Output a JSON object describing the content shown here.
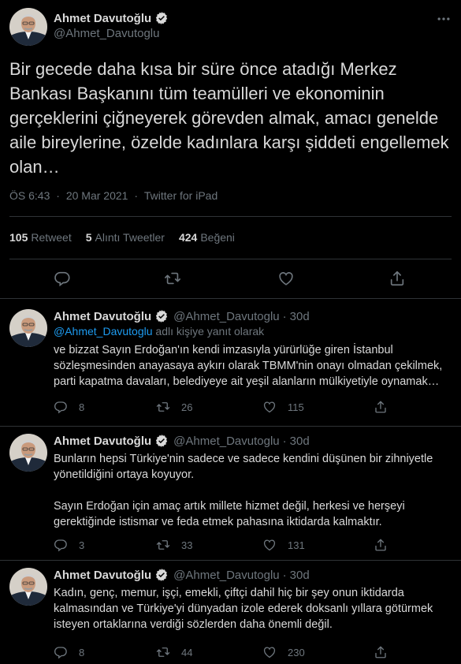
{
  "main_tweet": {
    "author_name": "Ahmet Davutoğlu",
    "handle": "@Ahmet_Davutoglu",
    "text": "Bir gecede daha kısa bir süre önce atadığı Merkez Bankası Başkanını tüm teamülleri ve ekonominin gerçeklerini çiğneyerek görevden almak, amacı genelde aile bireylerine, özelde kadınlara karşı şiddeti engellemek olan…",
    "time": "ÖS 6:43",
    "date": "20 Mar 2021",
    "source": "Twitter for iPad",
    "separator": "·",
    "stats": {
      "retweets_count": "105",
      "retweets_label": "Retweet",
      "quotes_count": "5",
      "quotes_label": "Alıntı Tweetler",
      "likes_count": "424",
      "likes_label": "Beğeni"
    }
  },
  "replies": [
    {
      "author_name": "Ahmet Davutoğlu",
      "handle": "@Ahmet_Davutoglu",
      "age": "30d",
      "separator": "·",
      "replying_mention": "@Ahmet_Davutoglu",
      "replying_suffix": "adlı kişiye yanıt olarak",
      "text": "ve bizzat Sayın Erdoğan'ın kendi imzasıyla yürürlüğe giren İstanbul sözleşmesinden anayasaya aykırı olarak TBMM'nin onayı olmadan çekilmek, parti kapatma davaları, belediyeye ait yeşil alanların mülkiyetiyle oynamak…",
      "reply_count": "8",
      "retweet_count": "26",
      "like_count": "115"
    },
    {
      "author_name": "Ahmet Davutoğlu",
      "handle": "@Ahmet_Davutoglu",
      "age": "30d",
      "separator": "·",
      "text": "Bunların hepsi Türkiye'nin sadece ve sadece kendini düşünen bir zihniyetle yönetildiğini ortaya koyuyor.\n\nSayın Erdoğan için amaç artık millete hizmet değil, herkesi ve herşeyi gerektiğinde istismar ve feda etmek pahasına iktidarda kalmaktır.",
      "reply_count": "3",
      "retweet_count": "33",
      "like_count": "131"
    },
    {
      "author_name": "Ahmet Davutoğlu",
      "handle": "@Ahmet_Davutoglu",
      "age": "30d",
      "separator": "·",
      "text": "Kadın, genç, memur, işçi, emekli, çiftçi dahil hiç bir şey onun iktidarda kalmasından ve Türkiye'yi dünyadan izole ederek doksanlı yıllara götürmek isteyen ortaklarına verdiği sözlerden daha önemli değil.",
      "reply_count": "8",
      "retweet_count": "44",
      "like_count": "230"
    }
  ],
  "icons": {
    "verified": "verified-badge-icon",
    "more": "more-icon",
    "reply": "reply-icon",
    "retweet": "retweet-icon",
    "like": "like-icon",
    "share": "share-icon"
  },
  "colors": {
    "background": "#000000",
    "text": "#d9d9d9",
    "muted": "#6e767d",
    "link": "#1d9bf0",
    "divider": "#2f3336"
  }
}
